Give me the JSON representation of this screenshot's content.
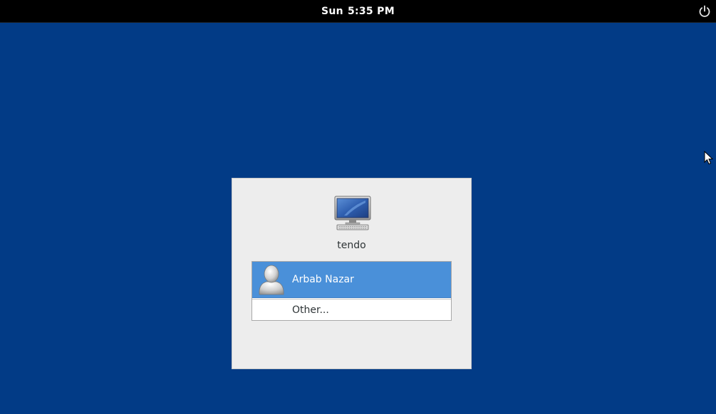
{
  "topbar": {
    "day": "Sun",
    "time": "5:35 PM",
    "power_icon": "power-icon"
  },
  "login": {
    "computer_icon": "computer-icon",
    "hostname": "tendo",
    "users": [
      {
        "name": "Arbab Nazar",
        "avatar_icon": "user-avatar-icon",
        "selected": true
      }
    ],
    "other_label": "Other..."
  },
  "colors": {
    "desktop_bg": "#023b86",
    "topbar_bg": "#000000",
    "dialog_bg": "#ededed",
    "selection": "#4a90d9"
  }
}
